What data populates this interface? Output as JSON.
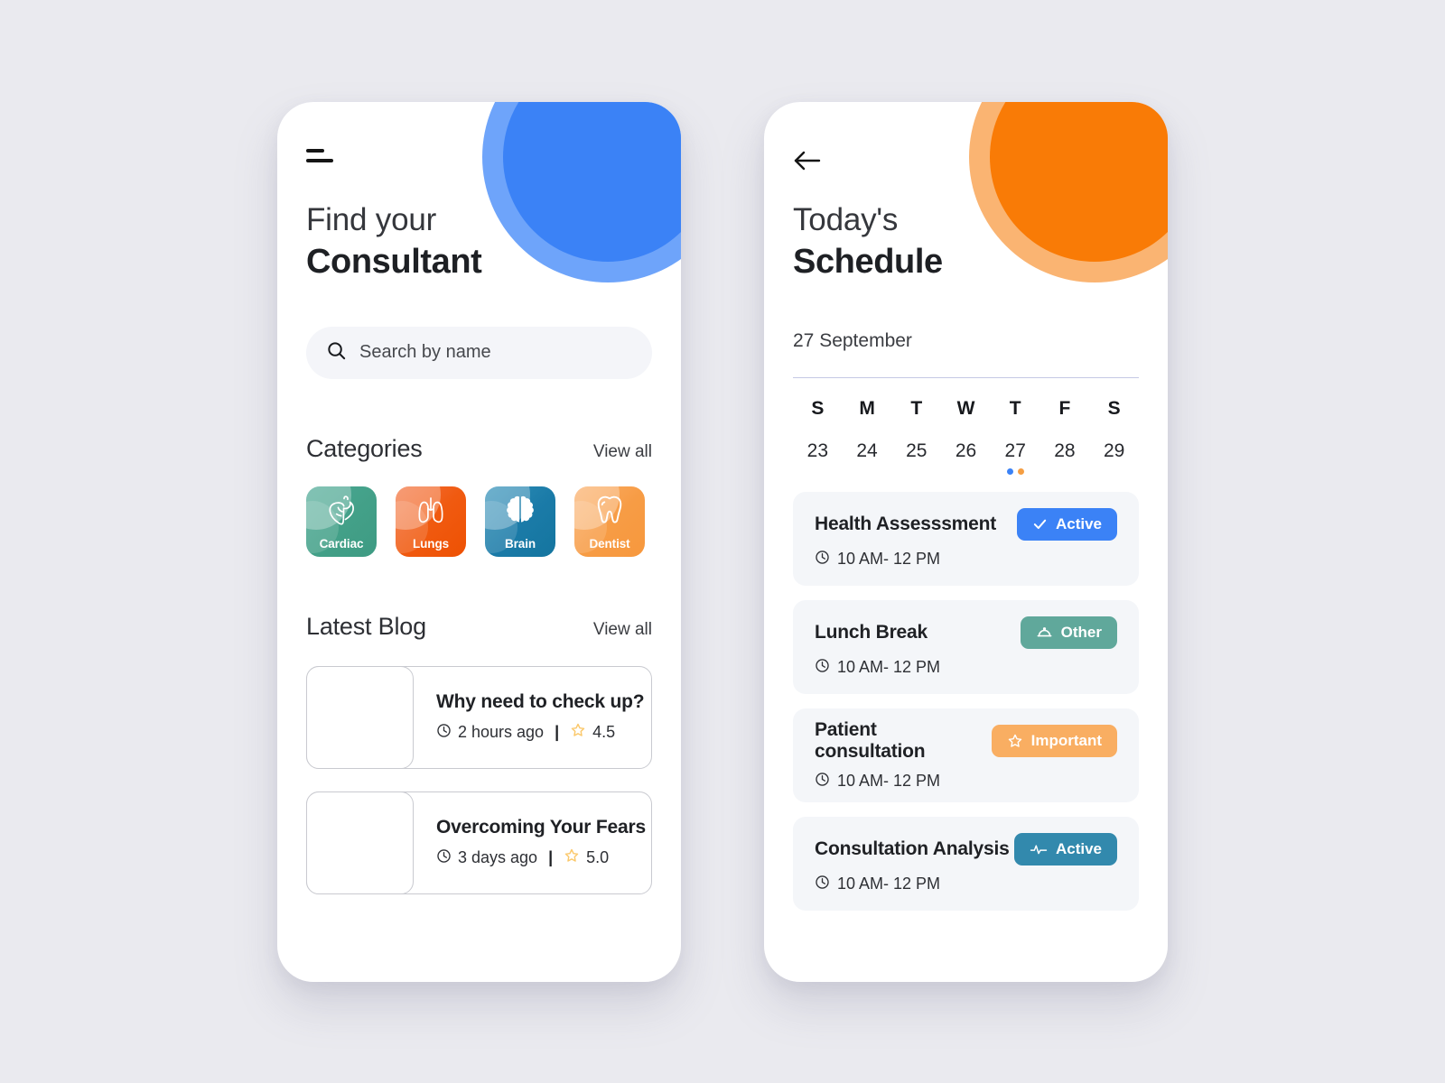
{
  "theme": {
    "page_background": "#eaeaef",
    "blue_primary": "#3b82f6",
    "blue_light": "#6ea4fa",
    "orange_primary": "#f97b06",
    "orange_light": "#fab472",
    "teal": "#43a090",
    "card_background": "#f4f6f9"
  },
  "left_screen": {
    "menu_icon": "hamburger-icon",
    "title_line1": "Find your",
    "title_line2": "Consultant",
    "search": {
      "icon": "search-icon",
      "placeholder": "Search by name",
      "value": ""
    },
    "categories_section": {
      "title": "Categories",
      "view_all": "View all",
      "items": [
        {
          "label": "Cardiac",
          "icon": "heart-anatomy-icon",
          "color": "#43a088",
          "color_dark": "#3e9b83"
        },
        {
          "label": "Lungs",
          "icon": "lungs-icon",
          "color": "#f05a10",
          "color_dark": "#ef5406"
        },
        {
          "label": "Brain",
          "icon": "brain-icon",
          "color": "#1b7ba8",
          "color_dark": "#14759f"
        },
        {
          "label": "Dentist",
          "icon": "tooth-icon",
          "color": "#f79c45",
          "color_dark": "#f7983d"
        }
      ]
    },
    "blog_section": {
      "title": "Latest Blog",
      "view_all": "View all",
      "items": [
        {
          "title": "Why need to check up?",
          "time_icon": "clock-icon",
          "time": "2 hours ago",
          "separator": "|",
          "rating_icon": "star-icon",
          "rating": "4.5"
        },
        {
          "title": "Overcoming Your Fears",
          "time_icon": "clock-icon",
          "time": "3 days ago",
          "separator": "|",
          "rating_icon": "star-icon",
          "rating": "5.0"
        }
      ]
    }
  },
  "right_screen": {
    "back_icon": "back-arrow-icon",
    "title_line1": "Today's",
    "title_line2": "Schedule",
    "date_label": "27 September",
    "calendar": {
      "day_initials": [
        "S",
        "M",
        "T",
        "W",
        "T",
        "F",
        "S"
      ],
      "dates": [
        "23",
        "24",
        "25",
        "26",
        "27",
        "28",
        "29"
      ],
      "selected_index": 4,
      "event_dots": {
        "4": [
          "#3b82f6",
          "#f59e42"
        ]
      }
    },
    "schedule": [
      {
        "title": "Health Assesssment",
        "time_icon": "clock-icon",
        "time": "10 AM- 12 PM",
        "badge": {
          "label": "Active",
          "icon": "check-icon",
          "color": "#3b82f6"
        }
      },
      {
        "title": "Lunch Break",
        "time_icon": "clock-icon",
        "time": "10 AM- 12 PM",
        "badge": {
          "label": "Other",
          "icon": "food-dome-icon",
          "color": "#60a89b"
        }
      },
      {
        "title": "Patient consultation",
        "time_icon": "clock-icon",
        "time": "10 AM- 12 PM",
        "badge": {
          "label": "Important",
          "icon": "star-icon",
          "color": "#f9ae62"
        }
      },
      {
        "title": "Consultation Analysis",
        "time_icon": "clock-icon",
        "time": "10 AM- 12 PM",
        "badge": {
          "label": "Active",
          "icon": "pulse-icon",
          "color": "#3289ad"
        }
      }
    ]
  }
}
